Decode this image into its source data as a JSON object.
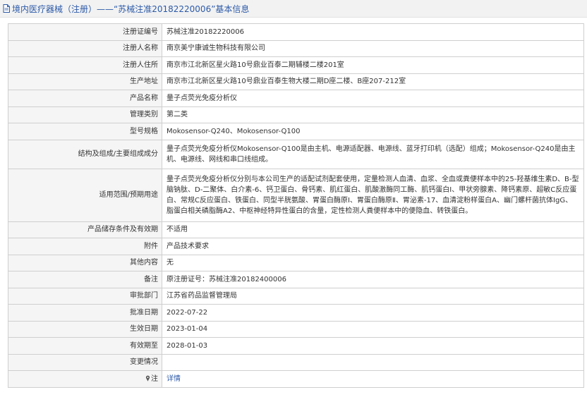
{
  "header": {
    "title": "境内医疗器械（注册）——“苏械注准20182220006”基本信息",
    "icon": "document-icon"
  },
  "rows": [
    {
      "label": "注册证编号",
      "value": "苏械注准20182220006"
    },
    {
      "label": "注册人名称",
      "value": "南京美宁康诚生物科技有限公司"
    },
    {
      "label": "注册人住所",
      "value": "南京市江北新区星火路10号鼎业百泰二期辅楼二楼201室"
    },
    {
      "label": "生产地址",
      "value": "南京市江北新区星火路10号鼎业百泰生物大楼二期D座二楼、B座207-212室"
    },
    {
      "label": "产品名称",
      "value": "量子点荧光免疫分析仪"
    },
    {
      "label": "管理类别",
      "value": "第二类"
    },
    {
      "label": "型号规格",
      "value": "Mokosensor-Q240、Mokosensor-Q100"
    },
    {
      "label": "结构及组成/主要组成成分",
      "value": "量子点荧光免疫分析仪Mokosensor-Q100是由主机、电源适配器、电源线、蓝牙打印机（选配）组成；Mokosensor-Q240是由主机、电源线、网线和串口线组成。"
    },
    {
      "label": "适用范围/预期用途",
      "value": "量子点荧光免疫分析仪分别与本公司生产的适配试剂配套使用，定量检测人血清、血浆、全血或粪便样本中的25-羟基维生素D、B-型脑钠肽、D-二聚体、白介素-6、钙卫蛋白、骨钙素、肌红蛋白、肌酸激酶同工酶、肌钙蛋白I、甲状旁腺素、降钙素原、超敏C反应蛋白、常规C反应蛋白、铁蛋白、同型半胱氨酸、胃蛋白酶原Ⅰ、胃蛋白酶原Ⅱ、胃泌素-17、血清淀粉样蛋白A、幽门螺杆菌抗体IgG、脂蛋白相关磷脂酶A2、中枢神经特异性蛋白的含量，定性检测人粪便样本中的便隐血、转铁蛋白。"
    },
    {
      "label": "产品储存条件及有效期",
      "value": "不适用"
    },
    {
      "label": "附件",
      "value": "产品技术要求"
    },
    {
      "label": "其他内容",
      "value": "无"
    },
    {
      "label": "备注",
      "value": "原注册证号：苏械注准20182400006"
    },
    {
      "label": "审批部门",
      "value": "江苏省药品监督管理局"
    },
    {
      "label": "批准日期",
      "value": "2022-07-22"
    },
    {
      "label": "生效日期",
      "value": "2023-01-04"
    },
    {
      "label": "有效期至",
      "value": "2028-01-03"
    },
    {
      "label": "变更情况",
      "value": ""
    }
  ],
  "note_row": {
    "label": "注",
    "icon": "pin-icon",
    "link_text": "详情"
  },
  "colors": {
    "link": "#2c5aa8",
    "label_bg": "#f5f5f5",
    "border": "#cfcfcf"
  }
}
